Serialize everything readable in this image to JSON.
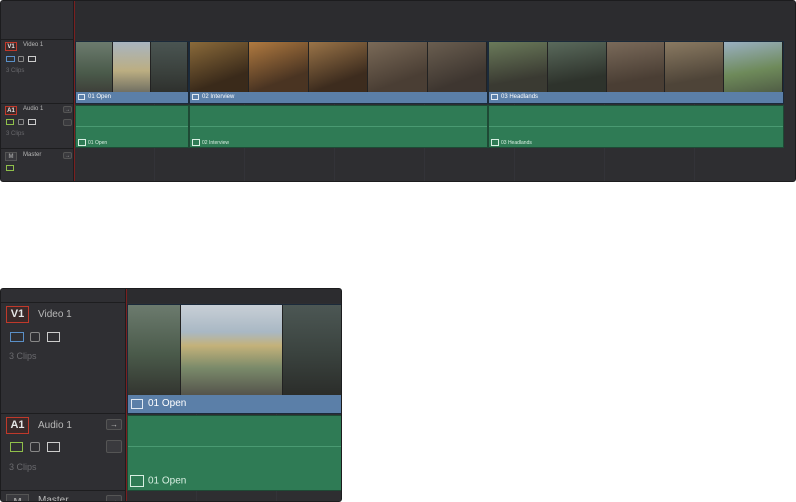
{
  "tracks": {
    "video": {
      "badge": "V1",
      "name": "Video 1",
      "clip_count": "3 Clips"
    },
    "audio": {
      "badge": "A1",
      "name": "Audio 1",
      "clip_count": "3 Clips"
    },
    "master": {
      "badge": "M",
      "name": "Master"
    }
  },
  "clips": [
    {
      "name": "01 Open"
    },
    {
      "name": "02 Interview"
    },
    {
      "name": "03 Headlands"
    }
  ],
  "colors": {
    "video_clip_label": "#5b7fa8",
    "audio_clip": "#2f7b55",
    "record_badge_border": "#c0392b",
    "playhead": "#7a2020"
  },
  "icons": [
    "monitor-icon",
    "lock-icon",
    "auto-select-icon",
    "speaker-icon",
    "arrow-icon",
    "solo-icon",
    "film-icon"
  ]
}
